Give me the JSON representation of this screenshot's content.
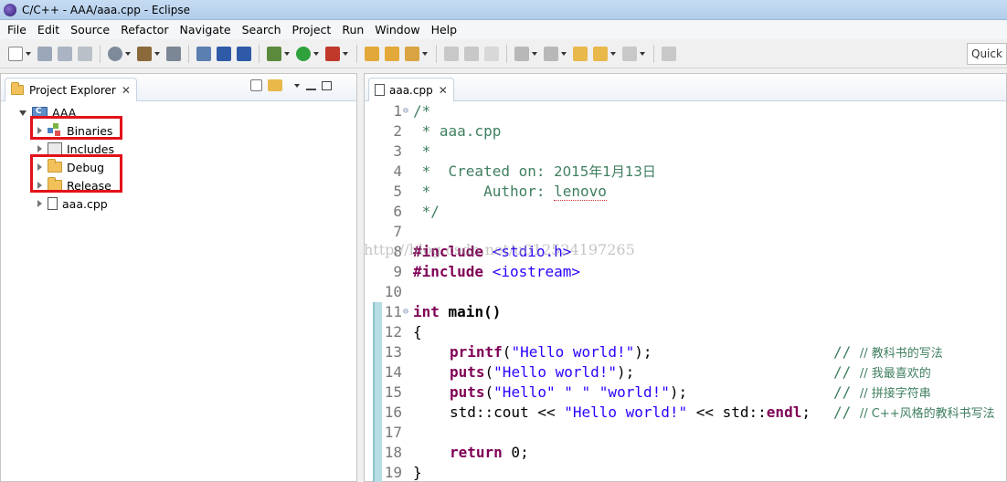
{
  "window": {
    "title": "C/C++ - AAA/aaa.cpp - Eclipse"
  },
  "menu": [
    "File",
    "Edit",
    "Source",
    "Refactor",
    "Navigate",
    "Search",
    "Project",
    "Run",
    "Window",
    "Help"
  ],
  "toolbar": {
    "quick_access_placeholder": "Quick Access"
  },
  "project_explorer": {
    "tab_label": "Project Explorer",
    "close_glyph": "✕",
    "tree": {
      "root": "AAA",
      "children": [
        "Binaries",
        "Includes",
        "Debug",
        "Release",
        "aaa.cpp"
      ]
    },
    "highlight_color": "#e3121a"
  },
  "editor": {
    "tab_label": "aaa.cpp",
    "close_glyph": "✕",
    "line_numbers": [
      "1",
      "2",
      "3",
      "4",
      "5",
      "6",
      "7",
      "8",
      "9",
      "10",
      "11",
      "12",
      "13",
      "14",
      "15",
      "16",
      "17",
      "18",
      "19"
    ],
    "lines": {
      "l1": "/*",
      "l2": " * aaa.cpp",
      "l3": " *",
      "l4_a": " *  Created on: ",
      "l4_b": "2015年1月13日",
      "l5_a": " *      Author: ",
      "l5_b": "lenovo",
      "l6": " */",
      "l8_kw": "#include",
      "l8_inc": " <stdio.h>",
      "l9_kw": "#include",
      "l9_inc": " <iostream>",
      "l11_kw": "int",
      "l11_rest": " main()",
      "l12": "{",
      "l13_fn": "printf",
      "l13_str": "\"Hello world!\"",
      "l13_end": ");",
      "l13_cm": "// 教科书的写法",
      "l14_fn": "puts",
      "l14_str": "\"Hello world!\"",
      "l14_end": ");",
      "l14_cm": "// 我最喜欢的",
      "l15_fn": "puts",
      "l15_str1": "\"Hello\"",
      "l15_str2": "\" \"",
      "l15_str3": "\"world!\"",
      "l15_end": ");",
      "l15_cm": "// 拼接字符串",
      "l16_a": "std::cout << ",
      "l16_str": "\"Hello world!\"",
      "l16_b": " << std::",
      "l16_kw": "endl",
      "l16_c": ";",
      "l16_cm": "// C++风格的教科书写法",
      "l18_kw": "return",
      "l18_rest": " 0;",
      "l19": "}"
    },
    "watermark": "http://blog.csdn.net/u012524197265"
  },
  "colors": {
    "keyword": "#7f0055",
    "string": "#2a00ff",
    "comment": "#3f7f5f",
    "highlight": "#e3121a"
  }
}
